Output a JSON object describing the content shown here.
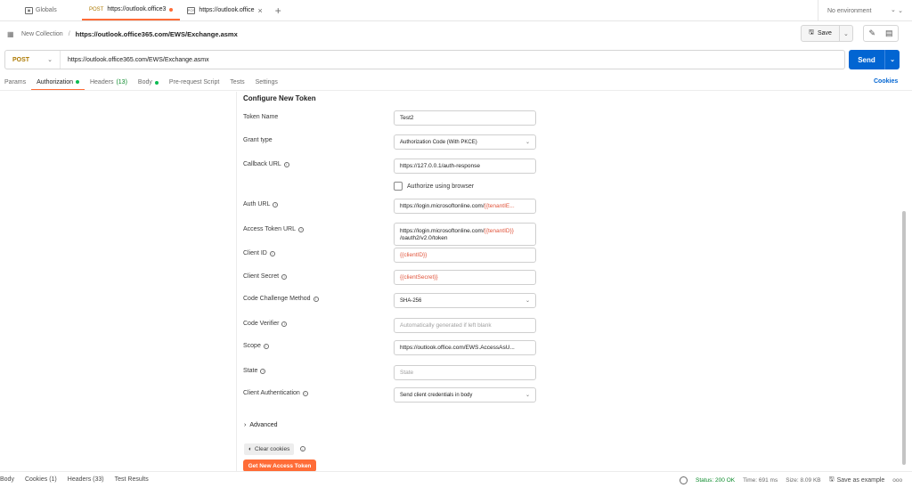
{
  "tabs": [
    {
      "label": "Globals"
    },
    {
      "method": "POST",
      "label": "https://outlook.office3"
    },
    {
      "label": "https://outlook.office"
    }
  ],
  "environment": "No environment",
  "breadcrumb": {
    "collection": "New Collection",
    "title": "https://outlook.office365.com/EWS/Exchange.asmx"
  },
  "toolbar": {
    "save_label": "Save"
  },
  "request": {
    "method": "POST",
    "url": "https://outlook.office365.com/EWS/Exchange.asmx",
    "send_label": "Send"
  },
  "request_tabs": {
    "params": "Params",
    "authorization": "Authorization",
    "headers": "Headers",
    "headers_count": "(13)",
    "body": "Body",
    "prerequest": "Pre-request Script",
    "tests": "Tests",
    "settings": "Settings",
    "cookies": "Cookies"
  },
  "form": {
    "section_title": "Configure New Token",
    "token_name": {
      "label": "Token Name",
      "value": "Test2"
    },
    "grant_type": {
      "label": "Grant type",
      "value": "Authorization Code (With PKCE)"
    },
    "callback_url": {
      "label": "Callback URL",
      "value": "https://127.0.0.1/auth-response"
    },
    "authorize_browser": {
      "label": "Authorize using browser"
    },
    "auth_url": {
      "label": "Auth URL",
      "prefix": "https://login.microsoftonline.com/",
      "var": "{{tenantIE..."
    },
    "access_token_url": {
      "label": "Access Token URL",
      "prefix": "https://login.microsoftonline.com/",
      "var": "{{tenantID}}",
      "line2": "/oauth2/v2.0/token"
    },
    "client_id": {
      "label": "Client ID",
      "value": "{{clientID}}"
    },
    "client_secret": {
      "label": "Client Secret",
      "value": "{{clientSecret}}"
    },
    "code_challenge": {
      "label": "Code Challenge Method",
      "value": "SHA-256"
    },
    "code_verifier": {
      "label": "Code Verifier",
      "placeholder": "Automatically generated if left blank"
    },
    "scope": {
      "label": "Scope",
      "value": "https://outlook.office.com/EWS.AccessAsU..."
    },
    "state": {
      "label": "State",
      "placeholder": "State"
    },
    "client_auth": {
      "label": "Client Authentication",
      "value": "Send client credentials in body"
    },
    "advanced": "Advanced",
    "clear_cookies": "Clear cookies",
    "get_token": "Get New Access Token"
  },
  "response": {
    "tabs": {
      "body": "Body",
      "cookies": "Cookies (1)",
      "headers": "Headers (33)",
      "test_results": "Test Results"
    },
    "status": "Status: 200 OK",
    "time": "Time: 691 ms",
    "size": "Size: 8.09 KB",
    "save_example": "Save as example",
    "more": "ooo"
  },
  "colors": {
    "accent": "#ff6c37",
    "send": "#0265d2",
    "post": "#ad7a03",
    "variable": "#e0533a",
    "ok": "#0a8a2a"
  }
}
